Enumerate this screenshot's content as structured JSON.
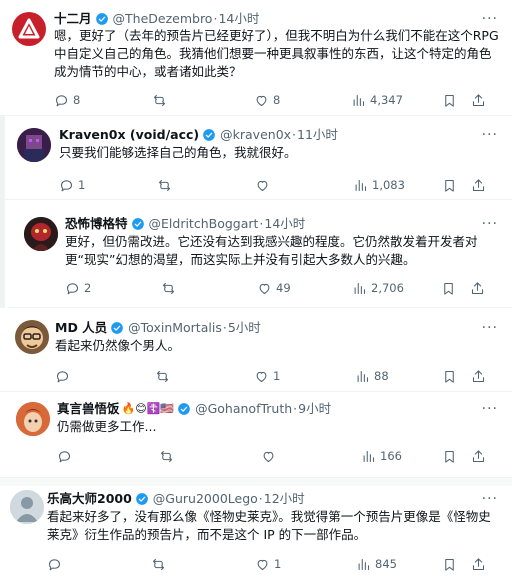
{
  "tweets": [
    {
      "name": "十二月",
      "handle": "@TheDezembro",
      "time": "14小时",
      "text": "嗯，更好了（去年的预告片已经更好了），但我不明白为什么我们不能在这个RPG 中自定义自己的角色。我猜他们想要一种更具叙事性的东西，让这个特定的角色成为情节的中心，或者诸如此类？",
      "replies": "8",
      "likes": "8",
      "views": "4,347",
      "avatar_icon": "red-triangle-logo"
    },
    {
      "name": "Kraven0x (void/acc)",
      "handle": "@kraven0x",
      "time": "11小时",
      "text": "只要我们能够选择自己的角色，我就很好。",
      "replies": "1",
      "likes": "",
      "views": "1,083",
      "avatar_icon": "pixel-character-avatar"
    },
    {
      "name": "恐怖博格特",
      "handle": "@EldritchBoggart",
      "time": "14小时",
      "text": "更好，但仍需改进。它还没有达到我感兴趣的程度。它仍然散发着开发者对更“现实”幻想的渴望，而这实际上并没有引起大多数人的兴趣。",
      "replies": "2",
      "likes": "49",
      "views": "2,706",
      "avatar_icon": "dark-creature-avatar"
    },
    {
      "name": "MD 人员",
      "handle": "@ToxinMortalis",
      "time": "5小时",
      "text": "看起来仍然像个男人。",
      "replies": "",
      "likes": "1",
      "views": "88",
      "avatar_icon": "cartoon-face-avatar"
    },
    {
      "name": "真言兽悟饭",
      "handle": "@GohanofTruth",
      "time": "9小时",
      "text": "仍需做更多工作...",
      "replies": "",
      "likes": "",
      "views": "166",
      "avatar_icon": "anime-character-avatar",
      "emojis": "🔥😊☦️🇺🇸"
    },
    {
      "name": "乐高大师2000",
      "handle": "@Guru2000Lego",
      "time": "12小时",
      "text": "看起来好多了，没有那么像《怪物史莱克》。我觉得第一个预告片更像是《怪物史莱克》衍生作品的预告片，而不是这个 IP 的下一部作品。",
      "replies": "",
      "likes": "1",
      "views": "845",
      "avatar_icon": "default-user-avatar"
    }
  ],
  "colors": {
    "verified": "#1d9bf0",
    "muted": "#536471",
    "text": "#0f1419",
    "divider": "#eff3f4"
  }
}
